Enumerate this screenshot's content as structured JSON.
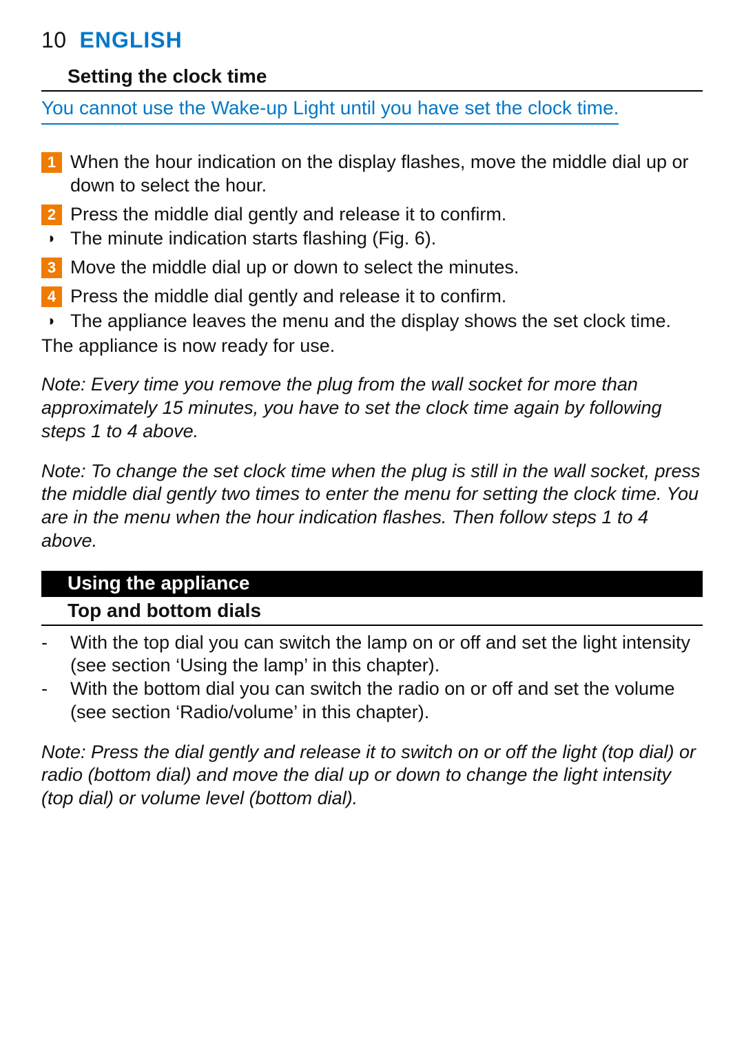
{
  "page_number": "10",
  "language_label": "ENGLISH",
  "section1": {
    "heading": "Setting the clock time",
    "intro": "You cannot use the Wake-up Light until you have set the clock time.",
    "steps": [
      {
        "n": "1",
        "text": "When the hour indication on the display flashes, move the middle dial up or down to select the hour."
      },
      {
        "n": "2",
        "text": "Press the middle dial gently and release it to confirm."
      }
    ],
    "result1": "The minute indication starts flashing (Fig. 6).",
    "steps2": [
      {
        "n": "3",
        "text": "Move the middle dial up or down to select the minutes."
      },
      {
        "n": "4",
        "text": "Press the middle dial gently and release it to confirm."
      }
    ],
    "result2": "The appliance leaves the menu and the display shows the set clock time.",
    "ready": "The appliance is now ready for use.",
    "note1": "Note: Every time you remove the plug from the wall socket for more than approximately 15 minutes, you have to set the clock time again by following steps 1 to 4 above.",
    "note2": "Note: To change the set clock time when the plug is still in the wall socket, press the middle dial gently two times to enter the menu for setting the clock time. You are in the menu when the hour indication flashes. Then follow steps 1 to 4 above."
  },
  "section2": {
    "bar": "Using the appliance",
    "heading": "Top and bottom dials",
    "items": [
      "With the top dial you can switch the lamp on or off and set the light intensity (see section ‘Using the lamp’ in this chapter).",
      "With the bottom dial you can switch the radio on or off and set the volume (see section ‘Radio/volume’ in this chapter)."
    ],
    "note": "Note: Press the dial gently and release it to switch on or off the light (top dial) or radio (bottom dial) and move the dial up or down to change the light intensity (top dial) or volume level (bottom dial)."
  }
}
